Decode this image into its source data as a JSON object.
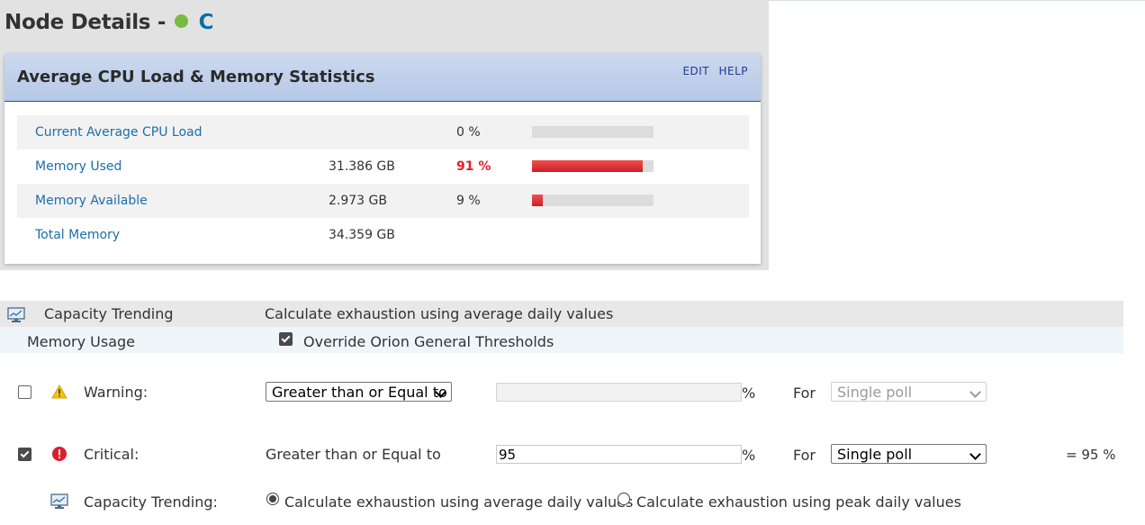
{
  "page": {
    "title_prefix": "Node Details -",
    "node_name": "C",
    "status_color": "#77bb41"
  },
  "panel": {
    "title": "Average CPU Load & Memory Statistics",
    "edit_label": "EDIT",
    "help_label": "HELP",
    "rows": [
      {
        "label": "Current Average CPU Load",
        "value": "",
        "percent": "0 %",
        "fraction": 0.0,
        "status": "normal"
      },
      {
        "label": "Memory Used",
        "value": "31.386 GB",
        "percent": "91 %",
        "fraction": 0.91,
        "status": "critical"
      },
      {
        "label": "Memory Available",
        "value": "2.973 GB",
        "percent": "9 %",
        "fraction": 0.09,
        "status": "normal"
      },
      {
        "label": "Total Memory",
        "value": "34.359 GB",
        "percent": "",
        "fraction": null,
        "status": "normal"
      }
    ]
  },
  "settings": {
    "capacity_trending": {
      "label": "Capacity Trending",
      "value": "Calculate exhaustion using average daily values",
      "icon": "chart-monitor-icon"
    },
    "memory_usage": {
      "label": "Memory Usage",
      "override_label": "Override Orion General Thresholds",
      "override_checked": true
    },
    "warning": {
      "label": "Warning:",
      "enabled": false,
      "operator": "Greater than or Equal to",
      "value": "",
      "unit": "%",
      "for_label": "For",
      "poll": "Single poll",
      "icon": "warning-triangle-icon"
    },
    "critical": {
      "label": "Critical:",
      "enabled": true,
      "operator": "Greater than or Equal to",
      "value": "95",
      "unit": "%",
      "for_label": "For",
      "poll": "Single poll",
      "result": "= 95 %",
      "icon": "critical-circle-icon"
    },
    "capacity_trending_option": {
      "label": "Capacity Trending:",
      "average_label": "Calculate exhaustion using average daily values",
      "peak_label": "Calculate exhaustion using peak daily values",
      "selected": "average"
    }
  }
}
